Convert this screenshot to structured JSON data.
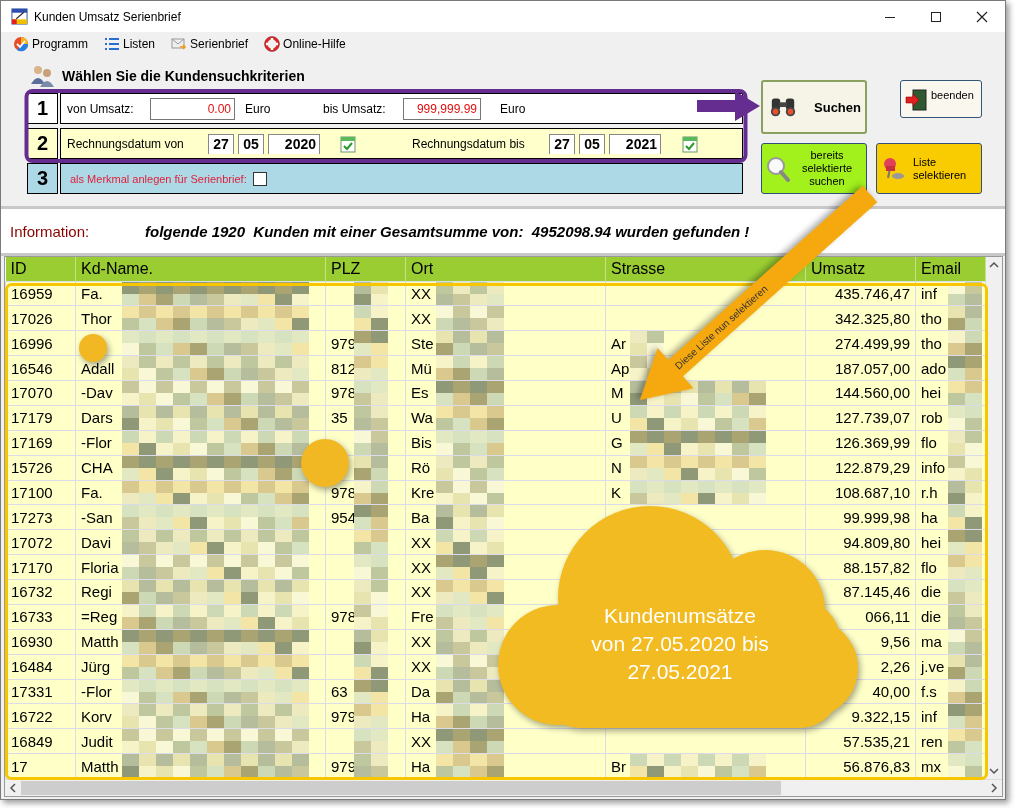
{
  "window": {
    "title": "Kunden Umsatz Serienbrief"
  },
  "menu": [
    "Programm",
    "Listen",
    "Serienbrief",
    "Online-Hilfe"
  ],
  "heading": "Wählen Sie die Kundensuchkriterien",
  "criteria": [
    {
      "kind": "amount",
      "number": "1",
      "from_label": "von Umsatz:",
      "from_value": "0.00",
      "from_unit": "Euro",
      "to_label": "bis Umsatz:",
      "to_value": "999,999.99",
      "to_unit": "Euro"
    },
    {
      "kind": "date",
      "number": "2",
      "from_label": "Rechnungsdatum von",
      "from_date": [
        "27",
        "05",
        "2020"
      ],
      "to_label": "Rechnungsdatum bis",
      "to_date": [
        "27",
        "05",
        "2021"
      ]
    },
    {
      "kind": "option",
      "number": "3",
      "label": "als Merkmal anlegen für Serienbrief:",
      "checked": false
    }
  ],
  "buttons": {
    "search": "Suchen",
    "exit": "beenden",
    "search_selected": "bereits selektierte suchen",
    "select_list": "Liste selektieren"
  },
  "information": {
    "label": "Information:",
    "message": "folgende 1920  Kunden mit einer Gesamtsumme von:  4952098.94 wurden gefunden !"
  },
  "table": {
    "columns": [
      "ID",
      "Kd-Name.",
      "PLZ",
      "Ort",
      "Strasse",
      "Umsatz",
      "Email"
    ],
    "rows": [
      [
        "16959",
        "Fa.",
        null,
        "XX",
        null,
        "435.746,47",
        "inf"
      ],
      [
        "17026",
        "Thor",
        null,
        "XX",
        null,
        "342.325,80",
        "tho"
      ],
      [
        "16996",
        null,
        "979",
        "Ste",
        "Ar",
        "274.499,99",
        "tho"
      ],
      [
        "16546",
        "Adall",
        "812",
        "Mü",
        "Ap",
        "187.057,00",
        "ado"
      ],
      [
        "17070",
        "-Dav",
        "978",
        "Es",
        "M",
        "144.560,00",
        "hei"
      ],
      [
        "17179",
        "Dars",
        "35",
        "Wa",
        "U",
        "127.739,07",
        "rob"
      ],
      [
        "17169",
        "-Flor",
        null,
        "Bis",
        "G",
        "126.369,99",
        "flo"
      ],
      [
        "15726",
        "CHA",
        null,
        "Rö",
        "N",
        "122.879,29",
        "info"
      ],
      [
        "17100",
        "Fa.",
        "978",
        "Kre",
        "K",
        "108.687,10",
        "r.h"
      ],
      [
        "17273",
        "-San",
        "954",
        "Ba",
        null,
        "99.999,98",
        "ha"
      ],
      [
        "17072",
        "Davi",
        null,
        "XX",
        null,
        "94.809,80",
        "hei"
      ],
      [
        "17170",
        "Floria",
        null,
        "XX",
        null,
        "88.157,82",
        "flo"
      ],
      [
        "16732",
        "Regi",
        null,
        "XX",
        null,
        "87.145,46",
        "die"
      ],
      [
        "16733",
        "=Reg",
        "978",
        "Fre",
        null,
        "066,11",
        "die"
      ],
      [
        "16930",
        "Matth",
        null,
        "XX",
        null,
        "9,56",
        "ma"
      ],
      [
        "16484",
        "Jürg",
        null,
        "XX",
        null,
        "2,26",
        "j.ve"
      ],
      [
        "17331",
        "-Flor",
        "63",
        "Da",
        null,
        "40,00",
        "f.s"
      ],
      [
        "16722",
        "Korv",
        "979",
        "Ha",
        null,
        "9.322,15",
        "inf"
      ],
      [
        "16849",
        "Judit",
        null,
        "XX",
        null,
        "57.535,21",
        "ren"
      ],
      [
        "17",
        "Matth",
        "979",
        "Ha",
        "Br",
        "56.876,83",
        "mx"
      ]
    ]
  },
  "annotations": {
    "arrow_label": "Diese Liste nun selektieren",
    "cloud_text": "Kundenumsätze\nvon 27.05.2020 bis\n27.05.2021"
  }
}
